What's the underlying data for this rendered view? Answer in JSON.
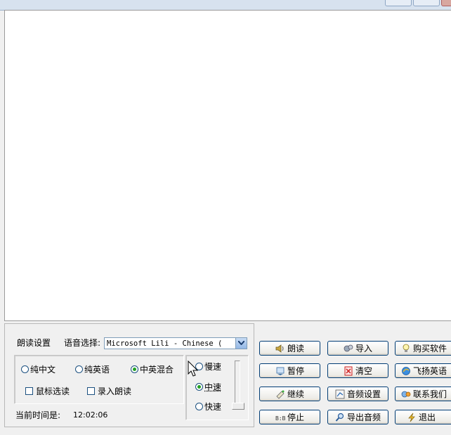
{
  "reading_settings": {
    "title": "朗读设置",
    "voice_label": "语音选择:",
    "voice_value": "Microsoft Lili - Chinese (",
    "mode": {
      "options": [
        "纯中文",
        "纯英语",
        "中英混合"
      ],
      "selected": "中英混合"
    },
    "checkboxes": [
      "鼠标选读",
      "录入朗读"
    ],
    "speed": {
      "options": [
        "慢速",
        "中速",
        "快速"
      ],
      "selected": "中速"
    },
    "time_label": "当前时间是:",
    "time_value": "12:02:06"
  },
  "buttons": {
    "read": "朗读",
    "pause": "暂停",
    "continue": "继续",
    "stop": "停止",
    "import": "导入",
    "clear": "清空",
    "audio_settings": "音频设置",
    "export_audio": "导出音频",
    "buy": "购买软件",
    "feiyang": "飞扬英语",
    "contact": "联系我们",
    "exit": "退出"
  },
  "colors": {
    "accent_green": "#21a121",
    "border_blue": "#003c74"
  }
}
